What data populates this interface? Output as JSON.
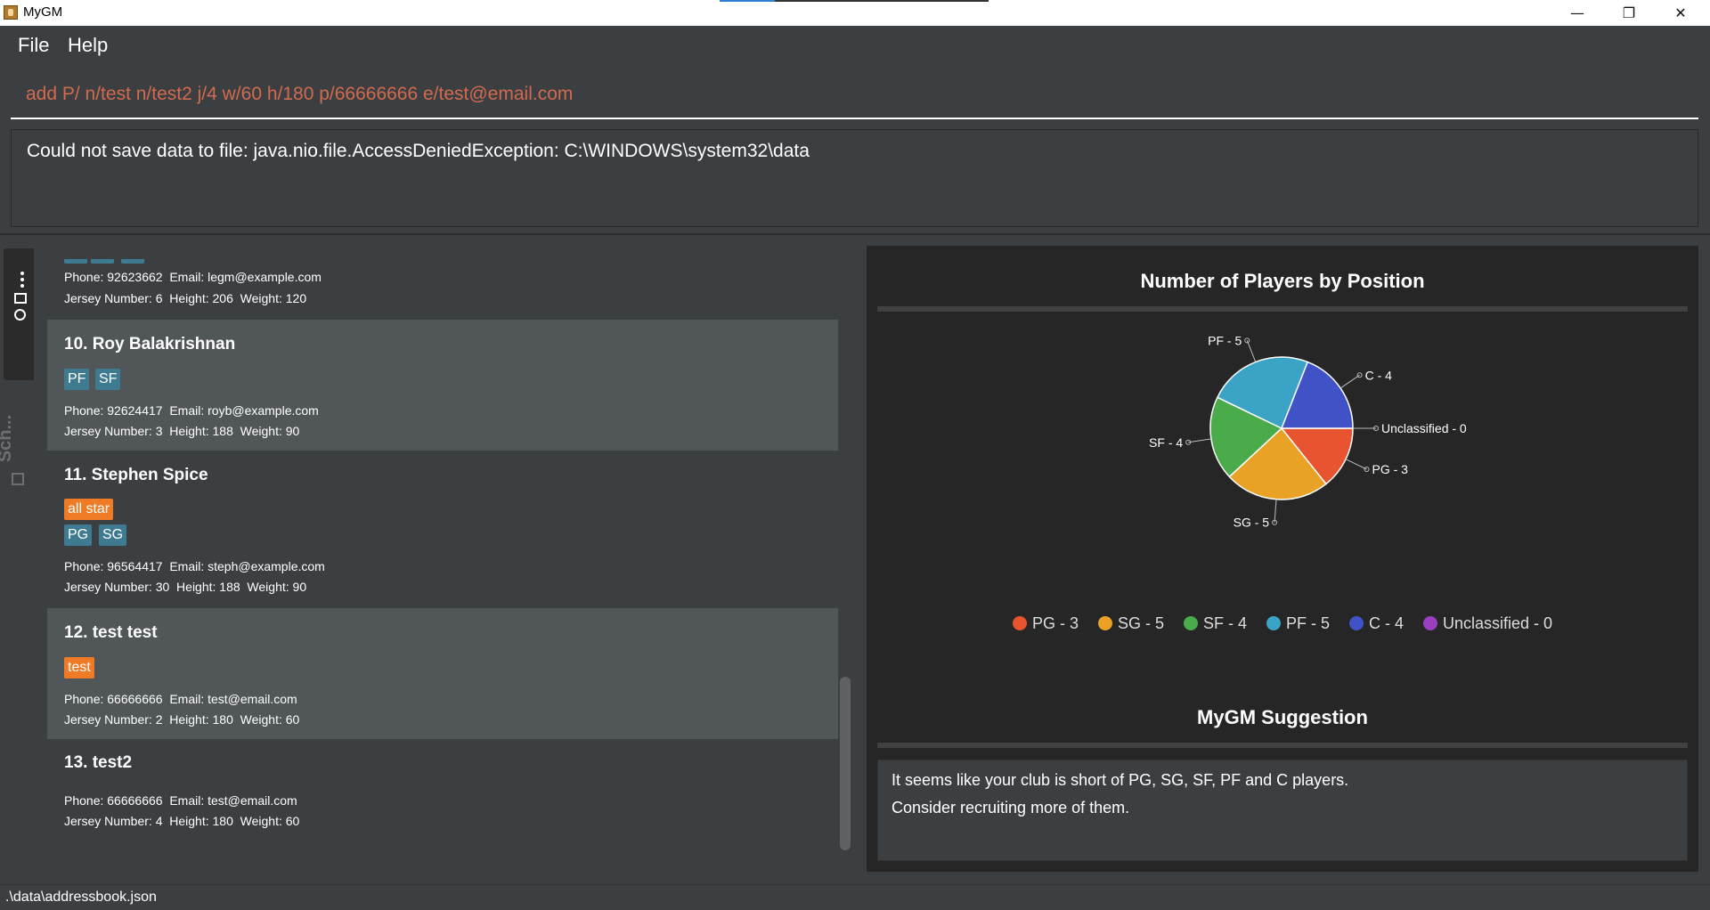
{
  "window": {
    "title": "MyGM",
    "minimize": "—",
    "maximize": "❐",
    "close": "✕"
  },
  "menu": {
    "file": "File",
    "help": "Help"
  },
  "command": {
    "value": "add P/ n/test n/test2 j/4 w/60 h/180 p/66666666 e/test@email.com"
  },
  "result": {
    "message": "Could not save data to file: java.nio.file.AccessDeniedException: C:\\WINDOWS\\system32\\data"
  },
  "tabs": {
    "schedule_label": "Sch..."
  },
  "players": [
    {
      "name": "",
      "tags": [],
      "positions": [],
      "contact": "Phone: 92623662  Email: legm@example.com",
      "stats": "Jersey Number: 6  Height: 206  Weight: 120"
    },
    {
      "name": "10.  Roy Balakrishnan",
      "tags": [],
      "positions": [
        "PF",
        "SF"
      ],
      "contact": "Phone: 92624417  Email: royb@example.com",
      "stats": "Jersey Number: 3  Height: 188  Weight: 90"
    },
    {
      "name": "11.  Stephen Spice",
      "tags": [
        "all star"
      ],
      "positions": [
        "PG",
        "SG"
      ],
      "contact": "Phone: 96564417  Email: steph@example.com",
      "stats": "Jersey Number: 30  Height: 188  Weight: 90"
    },
    {
      "name": "12.  test test",
      "tags": [
        "test"
      ],
      "positions": [],
      "contact": "Phone: 66666666  Email: test@email.com",
      "stats": "Jersey Number: 2  Height: 180  Weight: 60"
    },
    {
      "name": "13.  test2",
      "tags": [],
      "positions": [],
      "contact": "Phone: 66666666  Email: test@email.com",
      "stats": "Jersey Number: 4  Height: 180  Weight: 60"
    }
  ],
  "chart_data": {
    "type": "pie",
    "title": "Number of Players by Position",
    "categories": [
      "PG",
      "SG",
      "SF",
      "PF",
      "C",
      "Unclassified"
    ],
    "values": [
      3,
      5,
      4,
      5,
      4,
      0
    ],
    "slice_labels": [
      "PG - 3",
      "SG - 5",
      "SF - 4",
      "PF - 5",
      "C - 4",
      "Unclassified - 0"
    ],
    "colors": [
      "#e8542f",
      "#e9a126",
      "#4aab4a",
      "#3ba3c6",
      "#4152c6",
      "#9b3fc1"
    ],
    "legend": "bottom"
  },
  "suggestion": {
    "title": "MyGM Suggestion",
    "line1": "It seems like your club is short of PG, SG, SF, PF and C players.",
    "line2": "Consider recruiting more of them."
  },
  "status": {
    "path": ".\\data\\addressbook.json"
  }
}
